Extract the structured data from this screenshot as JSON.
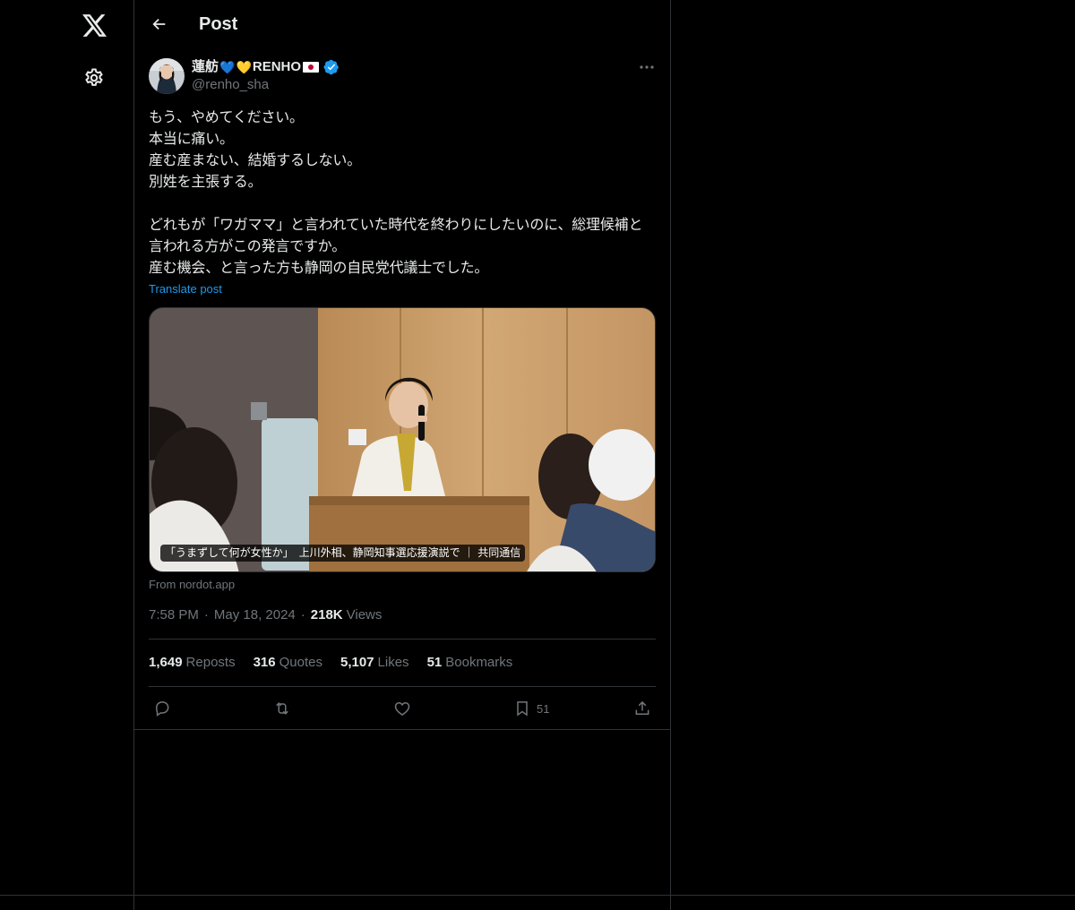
{
  "header": {
    "title": "Post"
  },
  "post": {
    "author": {
      "display_name": "蓮舫",
      "emoji_1": "💙",
      "emoji_2": "💛",
      "name_suffix": "RENHO",
      "handle": "@renho_sha"
    },
    "text": "もう、やめてください。\n本当に痛い。\n産む産まない、結婚するしない。\n別姓を主張する。\n\nどれもが「ワガママ」と言われていた時代を終わりにしたいのに、総理候補と言われる方がこの発言ですか。\n産む機会、と言った方も静岡の自民党代議士でした。",
    "translate_label": "Translate post",
    "card": {
      "caption": "「うまずして何が女性か」　上川外相、静岡知事選応援演説で ｜ 共同通信",
      "source": "From nordot.app"
    },
    "time": "7:58 PM",
    "date": "May 18, 2024",
    "views_count": "218K",
    "views_label": "Views",
    "stats": {
      "reposts": "1,649",
      "reposts_label": "Reposts",
      "quotes": "316",
      "quotes_label": "Quotes",
      "likes": "5,107",
      "likes_label": "Likes",
      "bookmarks": "51",
      "bookmarks_label": "Bookmarks"
    },
    "actions": {
      "bookmark_count": "51"
    }
  },
  "colors": {
    "background": "#000000",
    "text": "#e7e9ea",
    "muted": "#71767b",
    "accent": "#1d9bf0",
    "border": "#2f3336"
  },
  "icons": [
    "x-logo-icon",
    "settings-icon",
    "back-arrow-icon",
    "verified-icon",
    "more-icon",
    "reply-icon",
    "repost-icon",
    "like-icon",
    "bookmark-icon",
    "share-icon"
  ]
}
